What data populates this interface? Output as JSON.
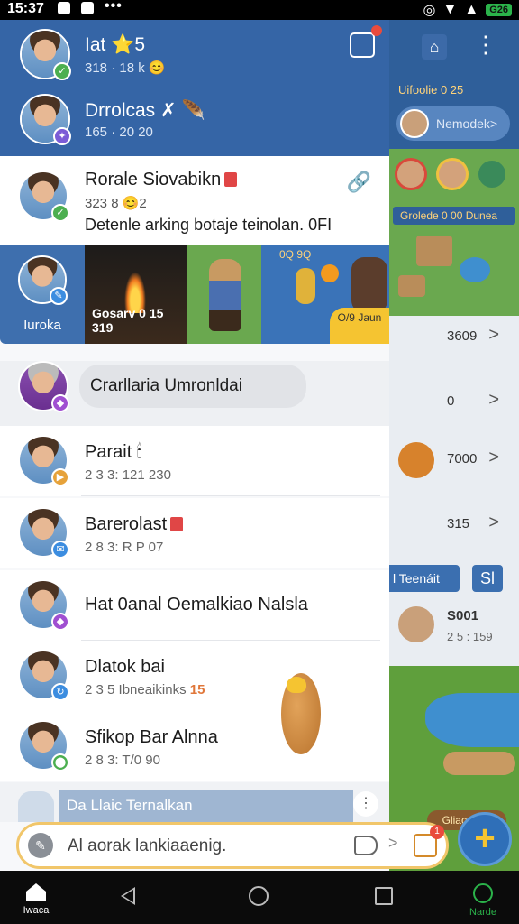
{
  "status": {
    "time": "15:37",
    "dots": "•••",
    "battery": "G26"
  },
  "background": {
    "top_label": "Uifoolie 0 25",
    "pill_text": "Nemodek>",
    "game_bar": "Grolede 0 00 Dunea",
    "rows": [
      {
        "value": "3609",
        "chev": ">"
      },
      {
        "value": "0",
        "chev": ">"
      },
      {
        "value": "7000",
        "chev": ">"
      },
      {
        "value": "315",
        "chev": ">"
      }
    ],
    "search_label": "l Teenáit",
    "search_icon": "Sl",
    "user_row": {
      "value": "S001",
      "meta": "2 5 : 159"
    },
    "map_label": "Gliao 0 26"
  },
  "drawer": {
    "accounts": [
      {
        "name": "Iat ⭐5",
        "meta": "318 · 18 k 😊",
        "badge_color": "#4caf50",
        "badge": "✓"
      },
      {
        "name": "Drrolcas ✗ 🪶",
        "meta": "165 · 20 20",
        "badge_color": "#7b5cd6",
        "badge": "✦"
      }
    ],
    "featured": {
      "title": "Rorale Siovabikn",
      "meta": "323 8 😊2",
      "message": "Detenle arking botaje teinolan. 0FI"
    },
    "media": {
      "side_label": "Iuroka",
      "tile1_caption": "Gosarv 0 15 319",
      "tile3_header": "0Q 9Q",
      "tile3_tag": "O/9 Jaun"
    },
    "bubble_text": "Crarllaria Umronldai",
    "chats": [
      {
        "title": "Parait 🕯",
        "meta": "2 3 3: 121 230",
        "badge_color": "#e6a23a",
        "badge": "▶"
      },
      {
        "title": "Barerolast",
        "meta": "2 8 3: R P 07",
        "badge_color": "#3c8de0",
        "badge": "✉"
      },
      {
        "title": "Hat 0anal Oemalkiao Nalsla",
        "meta": "",
        "badge_color": "#a04fd1",
        "badge": "◆"
      },
      {
        "title": "Dlatok bai",
        "meta": "2 3 5 Ibneaikinks",
        "meta_hl": "15",
        "badge_color": "#3c8de0",
        "badge": "↻"
      },
      {
        "title": "Sfikop Bar Alnna",
        "meta": "2 8 3: T/0 90",
        "badge_color": "#4caf50",
        "badge": "⬤"
      }
    ],
    "pinned": "Da Llaic Ternalkan",
    "pinned_more": "⋮"
  },
  "input": {
    "placeholder": "Al aorak lankiaaenig.",
    "chev": ">",
    "note_badge": "1"
  },
  "fab": "+",
  "nav": {
    "home_label": "Iwaca",
    "mode_label": "Narde"
  }
}
